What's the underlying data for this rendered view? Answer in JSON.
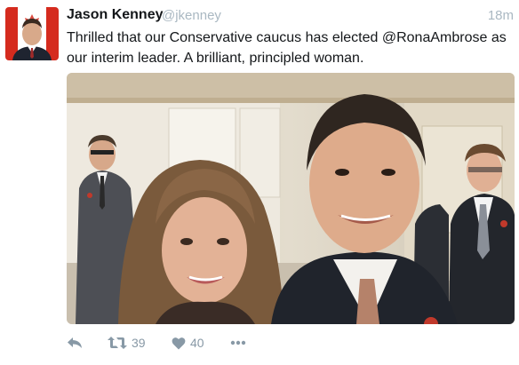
{
  "tweet": {
    "author_name": "Jason Kenney",
    "author_handle": "@jkenney",
    "time": "18m",
    "text": "Thrilled that our Conservative caucus has elected @RonaAmbrose as our interim leader. A brilliant, principled woman."
  },
  "actions": {
    "retweet_count": "39",
    "like_count": "40"
  },
  "colors": {
    "text": "#14171a",
    "muted": "#aab8c2",
    "action": "#8899a6"
  },
  "icons": [
    "reply-icon",
    "retweet-icon",
    "heart-icon",
    "more-icon"
  ]
}
